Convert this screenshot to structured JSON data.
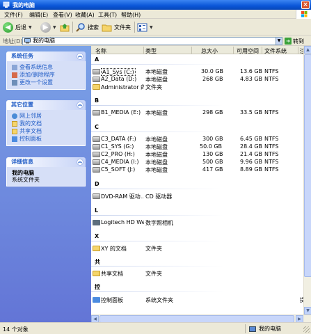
{
  "window": {
    "title": "我的电脑"
  },
  "menu": [
    "文件(F)",
    "编辑(E)",
    "查看(V)",
    "收藏(A)",
    "工具(T)",
    "帮助(H)"
  ],
  "toolbar": {
    "back": "后退",
    "search": "搜索",
    "folders": "文件夹"
  },
  "address": {
    "label": "地址(D)",
    "value": "我的电脑",
    "go": "转到"
  },
  "left_panel": {
    "system_tasks": {
      "title": "系统任务",
      "items": [
        "查看系统信息",
        "添加/删除程序",
        "更改一个设置"
      ]
    },
    "other_places": {
      "title": "其它位置",
      "items": [
        "网上邻居",
        "我的文档",
        "共享文档",
        "控制面板"
      ]
    },
    "details": {
      "title": "详细信息",
      "name": "我的电脑",
      "type": "系统文件夹"
    }
  },
  "columns": [
    "名称",
    "类型",
    "总大小",
    "可用空间",
    "文件系统",
    "注释"
  ],
  "groups": {
    "a": {
      "label": "A",
      "rows": [
        {
          "name": "A1_Sys (C:)",
          "type": "本地磁盘",
          "total": "30.0 GB",
          "free": "13.6 GB",
          "fs": "NTFS"
        },
        {
          "name": "A2_Data (D:)",
          "type": "本地磁盘",
          "total": "268 GB",
          "free": "4.83 GB",
          "fs": "NTFS"
        },
        {
          "name": "Administrator 的...",
          "type": "文件夹",
          "total": "",
          "free": "",
          "fs": ""
        }
      ]
    },
    "b": {
      "label": "B",
      "rows": [
        {
          "name": "B1_MEDIA (E:)",
          "type": "本地磁盘",
          "total": "298 GB",
          "free": "33.5 GB",
          "fs": "NTFS"
        }
      ]
    },
    "c": {
      "label": "C",
      "rows": [
        {
          "name": "C3_DATA (F:)",
          "type": "本地磁盘",
          "total": "300 GB",
          "free": "6.45 GB",
          "fs": "NTFS"
        },
        {
          "name": "C1_SYS (G:)",
          "type": "本地磁盘",
          "total": "50.0 GB",
          "free": "28.4 GB",
          "fs": "NTFS"
        },
        {
          "name": "C2_PRO (H:)",
          "type": "本地磁盘",
          "total": "130 GB",
          "free": "21.4 GB",
          "fs": "NTFS"
        },
        {
          "name": "C4_MEDIA (I:)",
          "type": "本地磁盘",
          "total": "500 GB",
          "free": "9.96 GB",
          "fs": "NTFS"
        },
        {
          "name": "C5_SOFT (J:)",
          "type": "本地磁盘",
          "total": "417 GB",
          "free": "8.89 GB",
          "fs": "NTFS"
        }
      ]
    },
    "d": {
      "label": "D",
      "rows": [
        {
          "name": "DVD-RAM 驱动...",
          "type": "CD 驱动器"
        }
      ]
    },
    "l": {
      "label": "L",
      "rows": [
        {
          "name": "Logitech HD Web...",
          "type": "数字照相机"
        }
      ]
    },
    "x": {
      "label": "X",
      "rows": [
        {
          "name": "XY 的文档",
          "type": "文件夹"
        }
      ]
    },
    "gong": {
      "label": "共",
      "rows": [
        {
          "name": "共享文档",
          "type": "文件夹"
        }
      ]
    },
    "kong": {
      "label": "控",
      "rows": [
        {
          "name": "控制面板",
          "type": "系统文件夹",
          "comment": "提供"
        }
      ]
    }
  },
  "status": {
    "count": "14 个对象",
    "location": "我的电脑"
  }
}
